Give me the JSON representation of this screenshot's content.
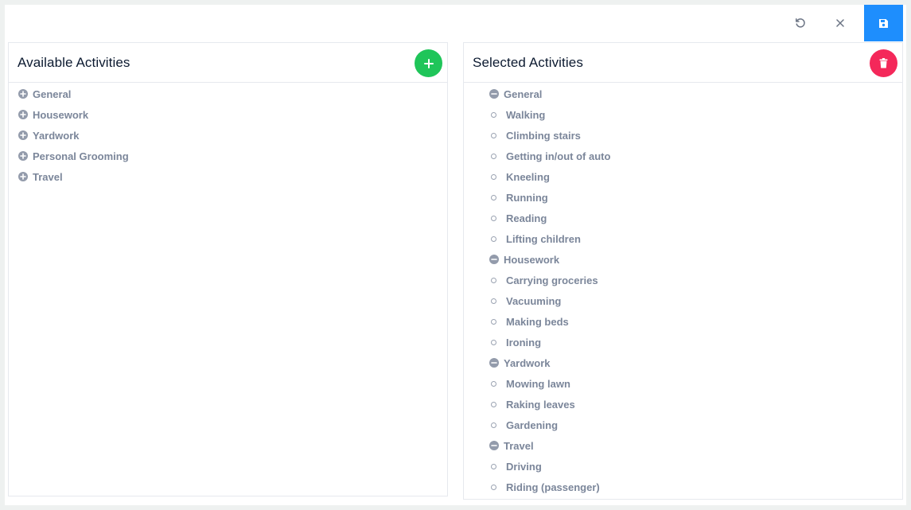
{
  "toolbar": {
    "undo_icon": "undo-icon",
    "close_icon": "close-icon",
    "save_icon": "save-icon",
    "save_color": "#1e8efd"
  },
  "available": {
    "title": "Available Activities",
    "add_icon": "plus-icon",
    "add_color": "#1fc559",
    "items": [
      "General",
      "Housework",
      "Yardwork",
      "Personal Grooming",
      "Travel"
    ]
  },
  "selected": {
    "title": "Selected Activities",
    "delete_icon": "trash-icon",
    "delete_color": "#f4285a",
    "groups": [
      {
        "label": "General",
        "items": [
          "Walking",
          "Climbing stairs",
          "Getting in/out of auto",
          "Kneeling",
          "Running",
          "Reading",
          "Lifting children"
        ]
      },
      {
        "label": "Housework",
        "items": [
          "Carrying groceries",
          "Vacuuming",
          "Making beds",
          "Ironing"
        ]
      },
      {
        "label": "Yardwork",
        "items": [
          "Mowing lawn",
          "Raking leaves",
          "Gardening"
        ]
      },
      {
        "label": "Travel",
        "items": [
          "Driving",
          "Riding (passenger)"
        ]
      }
    ]
  }
}
